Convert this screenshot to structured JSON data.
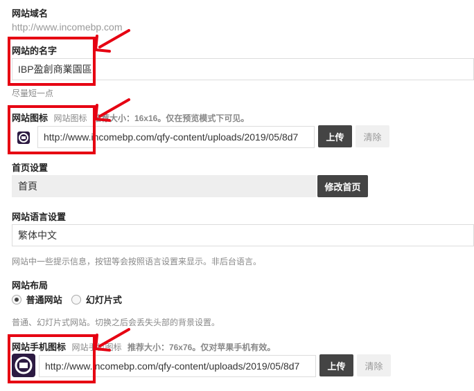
{
  "domain": {
    "label": "网站域名",
    "value": "http://www.incomebp.com"
  },
  "site_name": {
    "label": "网站的名字",
    "value": "IBP盈創商業園區",
    "hint": "尽量短一点"
  },
  "site_icon": {
    "label": "网站图标",
    "hint_prefix": "网站图标",
    "hint_bold": "推荐大小：16x16",
    "hint_suffix": "。仅在预览模式下可见。",
    "url": "http://www.incomebp.com/qfy-content/uploads/2019/05/8d7",
    "upload_label": "上传",
    "clear_label": "清除"
  },
  "homepage": {
    "label": "首页设置",
    "value": "首頁",
    "edit_label": "修改首页"
  },
  "language": {
    "label": "网站语言设置",
    "value": "繁体中文",
    "hint": "网站中一些提示信息，按钮等会按照语言设置来显示。非后台语言。"
  },
  "layout": {
    "label": "网站布局",
    "options": [
      {
        "label": "普通网站",
        "selected": true
      },
      {
        "label": "幻灯片式",
        "selected": false
      }
    ],
    "hint": "普通、幻灯片式网站。切换之后会丢失头部的背景设置。"
  },
  "mobile_icon": {
    "label": "网站手机图标",
    "hint_prefix": "网站手机图标",
    "hint_bold": "推荐大小：76x76",
    "hint_suffix": "。仅对苹果手机有效。",
    "url": "http://www.incomebp.com/qfy-content/uploads/2019/05/8d7",
    "upload_label": "上传",
    "clear_label": "清除"
  },
  "colors": {
    "annotation_red": "#e60012",
    "button_dark": "#444444",
    "favicon_bg": "#2c1a42"
  }
}
